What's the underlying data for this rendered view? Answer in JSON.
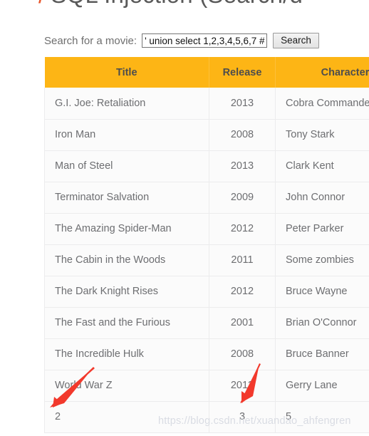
{
  "page": {
    "heading_prefix": "/",
    "heading": "SQL Injection (Search/d"
  },
  "search": {
    "label": "Search for a movie:",
    "input_value": "' union select 1,2,3,4,5,6,7 #",
    "input_placeholder": "",
    "button_label": "Search"
  },
  "table": {
    "columns": [
      "Title",
      "Release",
      "Character"
    ],
    "rows": [
      {
        "title": "G.I. Joe: Retaliation",
        "release": "2013",
        "character": "Cobra Commander"
      },
      {
        "title": "Iron Man",
        "release": "2008",
        "character": "Tony Stark"
      },
      {
        "title": "Man of Steel",
        "release": "2013",
        "character": "Clark Kent"
      },
      {
        "title": "Terminator Salvation",
        "release": "2009",
        "character": "John Connor"
      },
      {
        "title": "The Amazing Spider-Man",
        "release": "2012",
        "character": "Peter Parker"
      },
      {
        "title": "The Cabin in the Woods",
        "release": "2011",
        "character": "Some zombies"
      },
      {
        "title": "The Dark Knight Rises",
        "release": "2012",
        "character": "Bruce Wayne"
      },
      {
        "title": "The Fast and the Furious",
        "release": "2001",
        "character": "Brian O'Connor"
      },
      {
        "title": "The Incredible Hulk",
        "release": "2008",
        "character": "Bruce Banner"
      },
      {
        "title": "World War Z",
        "release": "2013",
        "character": "Gerry Lane"
      },
      {
        "title": "2",
        "release": "3",
        "character": "5"
      }
    ]
  },
  "annotations": {
    "arrow_color": "#f2392c",
    "arrow_1_name": "arrow-pointing-to-title-column-injected-value",
    "arrow_2_name": "arrow-pointing-to-release-column-injected-value"
  },
  "watermark": {
    "text": "https://blog.csdn.net/xuandao_ahfengren"
  },
  "colors": {
    "table_header_bg": "#fdb515",
    "table_header_text": "#4d4d4d",
    "cell_text": "#6d6e71",
    "heading_slash": "#e8552a",
    "accent_red": "#f2392c"
  }
}
